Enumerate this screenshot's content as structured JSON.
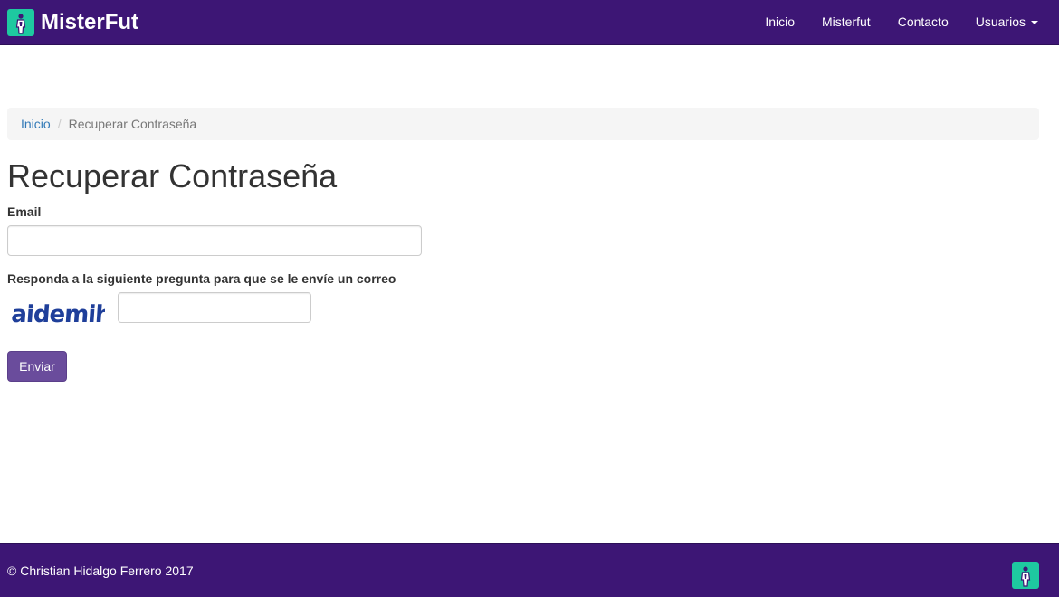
{
  "navbar": {
    "brand": "MisterFut",
    "logo_icon": "player-logo-icon",
    "items": [
      {
        "label": "Inicio"
      },
      {
        "label": "Misterfut"
      },
      {
        "label": "Contacto"
      },
      {
        "label": "Usuarios"
      }
    ]
  },
  "breadcrumb": {
    "home": "Inicio",
    "separator": "/",
    "current": "Recuperar Contraseña"
  },
  "page": {
    "title": "Recuperar Contraseña"
  },
  "form": {
    "email_label": "Email",
    "email_value": "",
    "captcha_label": "Responda a la siguiente pregunta para que se le envíe un correo",
    "captcha_text": "aidemih",
    "captcha_value": "",
    "submit_label": "Enviar"
  },
  "footer": {
    "copyright": "© Christian Hidalgo Ferrero 2017"
  },
  "colors": {
    "navbar_bg": "#3d1675",
    "logo_bg": "#1ec9a0",
    "button_bg": "#6a4c9c",
    "link": "#337ab7"
  }
}
